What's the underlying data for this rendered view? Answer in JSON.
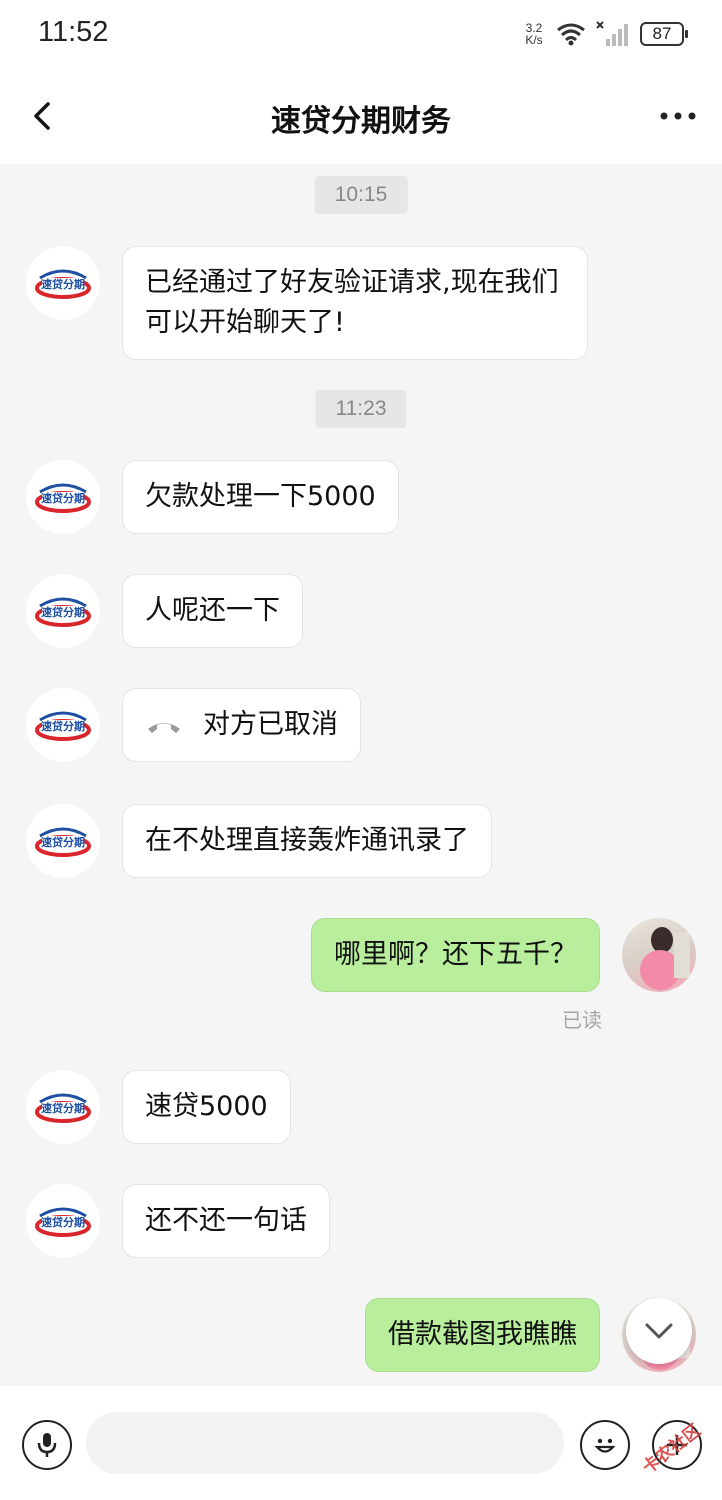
{
  "status_bar": {
    "time": "11:52",
    "net_speed_value": "3.2",
    "net_speed_unit": "K/s",
    "battery": "87"
  },
  "header": {
    "title": "速贷分期财务"
  },
  "contact_logo": {
    "text": "速贷分期",
    "colors": {
      "blue": "#1e4fa3",
      "red": "#d9262c"
    }
  },
  "colors": {
    "sent_bubble": "#b9ef9c",
    "received_bubble": "#ffffff",
    "background": "#f5f5f5"
  },
  "messages": [
    {
      "type": "time",
      "text": "10:15"
    },
    {
      "type": "received",
      "text": "已经通过了好友验证请求,现在我们可以开始聊天了!"
    },
    {
      "type": "time",
      "text": "11:23"
    },
    {
      "type": "received",
      "text": "欠款处理一下5000"
    },
    {
      "type": "received",
      "text": "人呢还一下"
    },
    {
      "type": "received_call",
      "text": "对方已取消",
      "icon": "phone-hangup-icon"
    },
    {
      "type": "received",
      "text": "在不处理直接轰炸通讯录了"
    },
    {
      "type": "sent",
      "text": "哪里啊？还下五千？",
      "status": "已读"
    },
    {
      "type": "received",
      "text": "速贷5000"
    },
    {
      "type": "received",
      "text": "还不还一句话"
    },
    {
      "type": "sent",
      "text": "借款截图我瞧瞧"
    }
  ],
  "input": {
    "placeholder": ""
  },
  "watermark": {
    "text": "卡农社区"
  }
}
